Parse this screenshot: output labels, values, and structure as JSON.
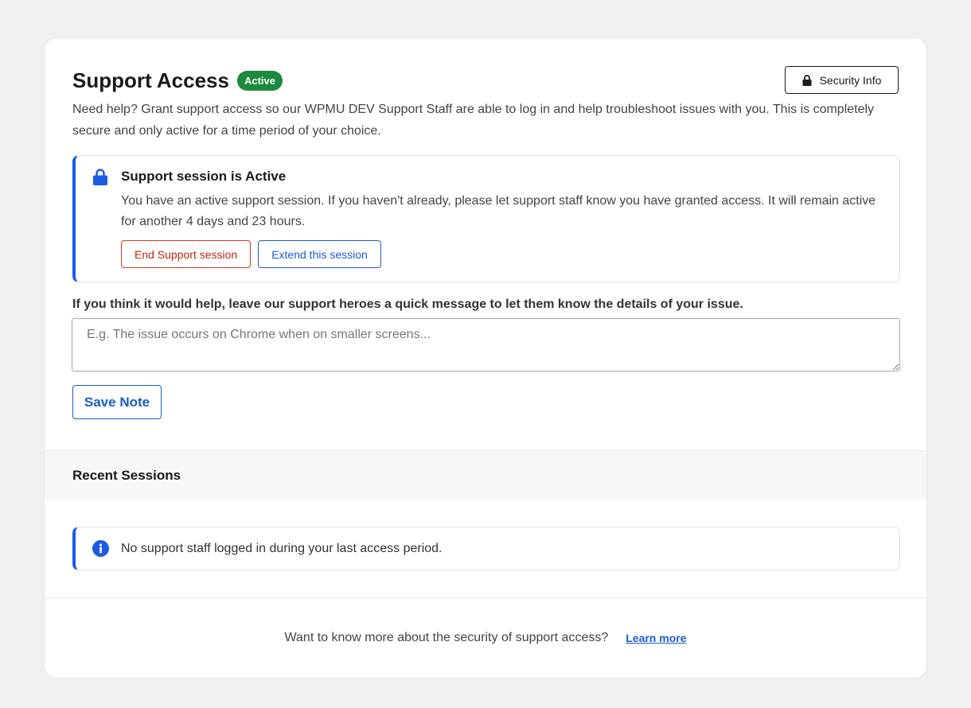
{
  "header": {
    "title": "Support Access",
    "badge": "Active",
    "security_button": "Security Info",
    "security_icon": "lock-icon",
    "description": "Need help? Grant support access so our WPMU DEV Support Staff are able to log in and help troubleshoot issues with you. This is completely secure and only active for a time period of your choice."
  },
  "session_notice": {
    "icon": "lock-icon",
    "title": "Support session is Active",
    "text": "You have an active support session. If you haven't already, please let support staff know you have granted access. It will remain active for another 4 days and 23 hours.",
    "end_button": "End Support session",
    "extend_button": "Extend this session"
  },
  "note": {
    "label": "If you think it would help, leave our support heroes a quick message to let them know the details of your issue.",
    "placeholder": "E.g. The issue occurs on Chrome when on smaller screens...",
    "value": "",
    "save_button": "Save Note"
  },
  "recent": {
    "heading": "Recent Sessions",
    "icon": "info-icon",
    "empty_text": "No support staff logged in during your last access period."
  },
  "footer": {
    "text": "Want to know more about the security of support access?",
    "link": "Learn more"
  },
  "colors": {
    "accent": "#1a5ce6",
    "badge": "#1a8a3d",
    "danger": "#c0260e"
  }
}
